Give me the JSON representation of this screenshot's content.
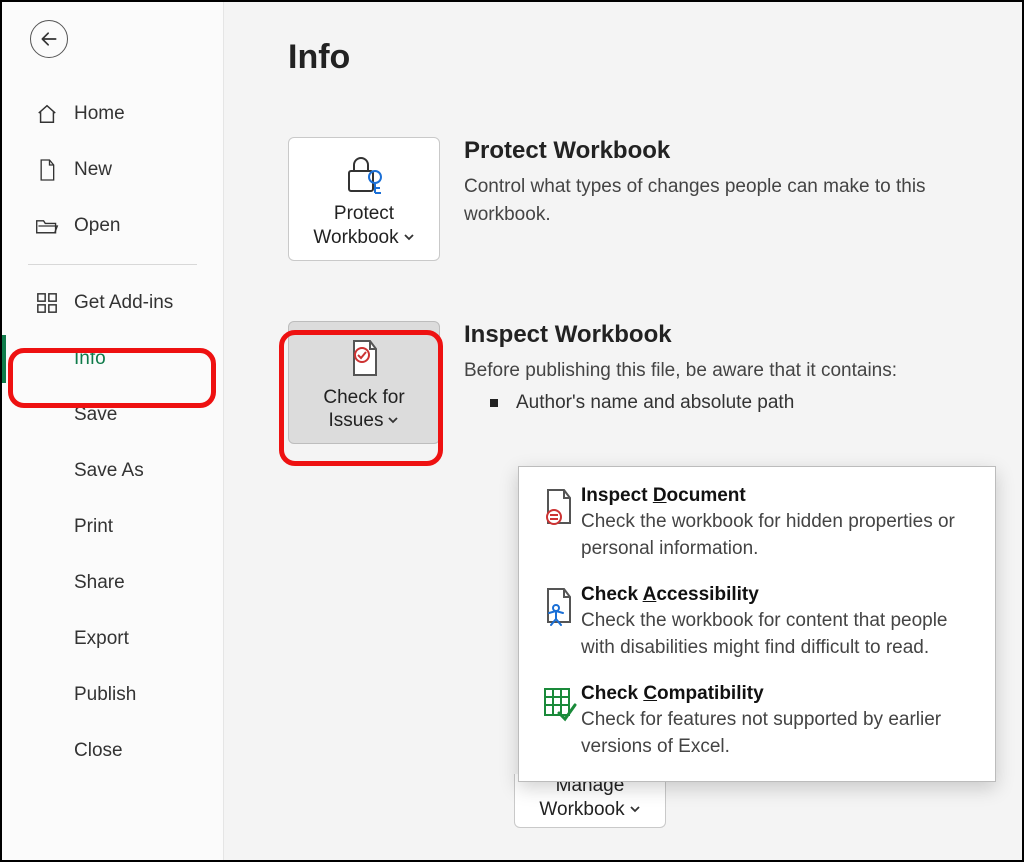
{
  "sidebar": {
    "items": [
      {
        "label": "Home"
      },
      {
        "label": "New"
      },
      {
        "label": "Open"
      },
      {
        "label": "Get Add-ins"
      },
      {
        "label": "Info"
      },
      {
        "label": "Save"
      },
      {
        "label": "Save As"
      },
      {
        "label": "Print"
      },
      {
        "label": "Share"
      },
      {
        "label": "Export"
      },
      {
        "label": "Publish"
      },
      {
        "label": "Close"
      }
    ]
  },
  "page": {
    "title": "Info"
  },
  "protect": {
    "button_line1": "Protect",
    "button_line2": "Workbook",
    "title": "Protect Workbook",
    "desc": "Control what types of changes people can make to this workbook."
  },
  "inspect": {
    "button_line1": "Check for",
    "button_line2": "Issues",
    "title": "Inspect Workbook",
    "desc": "Before publishing this file, be aware that it contains:",
    "bullet1": "Author's name and absolute path"
  },
  "menu": {
    "inspect_doc": {
      "title_pre": "Inspect ",
      "title_u": "D",
      "title_post": "ocument",
      "desc": "Check the workbook for hidden properties or personal information."
    },
    "accessibility": {
      "title_pre": "Check ",
      "title_u": "A",
      "title_post": "ccessibility",
      "desc": "Check the workbook for content that people with disabilities might find difficult to read."
    },
    "compatibility": {
      "title_pre": "Check ",
      "title_u": "C",
      "title_post": "ompatibility",
      "desc": "Check for features not supported by earlier versions of Excel."
    }
  },
  "manage": {
    "line1": "Manage",
    "line2": "Workbook"
  }
}
